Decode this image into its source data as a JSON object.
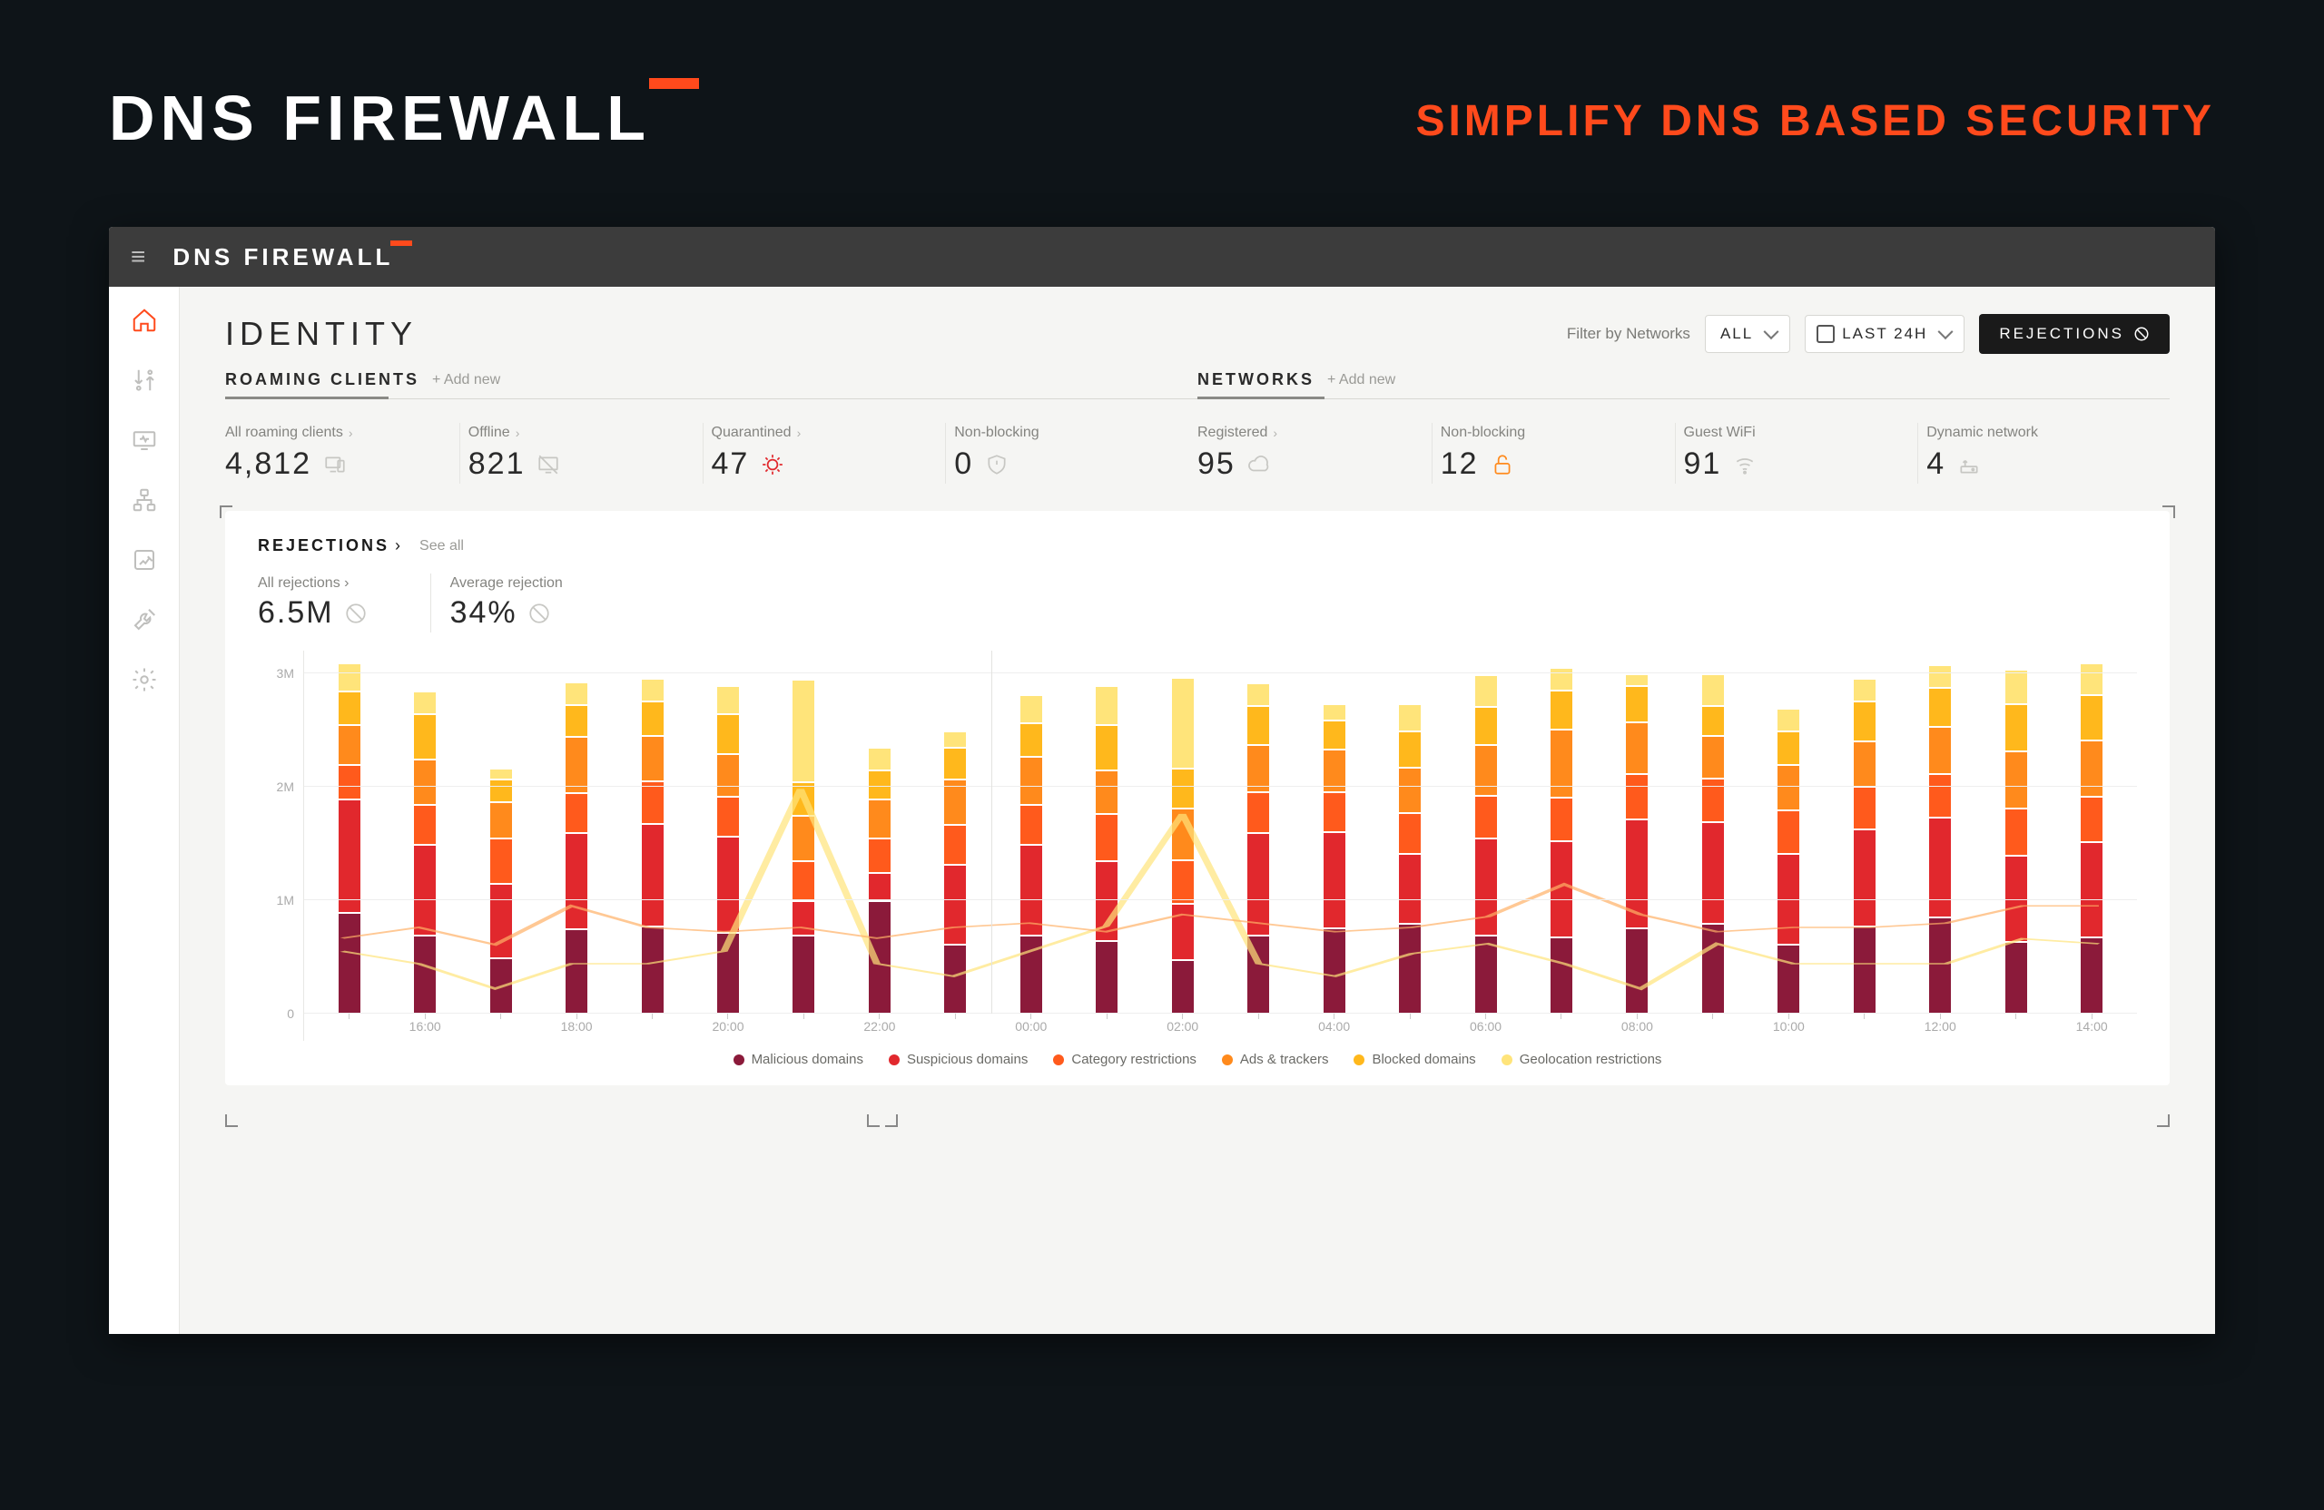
{
  "hero": {
    "title": "DNS FIREWALL",
    "tagline": "SIMPLIFY DNS BASED SECURITY"
  },
  "app_title": "DNS FIREWALL",
  "sidebar": [
    {
      "name": "home",
      "active": true
    },
    {
      "name": "traffic",
      "active": false
    },
    {
      "name": "monitor",
      "active": false
    },
    {
      "name": "network",
      "active": false
    },
    {
      "name": "reports",
      "active": false
    },
    {
      "name": "tools",
      "active": false
    },
    {
      "name": "settings",
      "active": false
    }
  ],
  "page": {
    "title": "IDENTITY",
    "filter_label": "Filter by Networks",
    "network_select": "ALL",
    "time_select": "LAST 24H",
    "rejections_button": "REJECTIONS"
  },
  "tabs": {
    "roaming": {
      "title": "ROAMING CLIENTS",
      "add": "Add new"
    },
    "networks": {
      "title": "NETWORKS",
      "add": "Add new"
    }
  },
  "stats": {
    "roaming": [
      {
        "label": "All roaming clients",
        "value": "4,812",
        "icon": "device",
        "link": true
      },
      {
        "label": "Offline",
        "value": "821",
        "icon": "offline",
        "link": true
      },
      {
        "label": "Quarantined",
        "value": "47",
        "icon": "virus",
        "icon_color": "red",
        "link": true
      },
      {
        "label": "Non-blocking",
        "value": "0",
        "icon": "shield",
        "link": false
      }
    ],
    "networks": [
      {
        "label": "Registered",
        "value": "95",
        "icon": "cloud",
        "link": true
      },
      {
        "label": "Non-blocking",
        "value": "12",
        "icon": "unlock",
        "icon_color": "orange",
        "link": false
      },
      {
        "label": "Guest WiFi",
        "value": "91",
        "icon": "wifi",
        "link": false
      },
      {
        "label": "Dynamic network",
        "value": "4",
        "icon": "router",
        "link": false
      }
    ]
  },
  "rejections": {
    "title": "REJECTIONS",
    "see_all": "See all",
    "summary": [
      {
        "label": "All rejections",
        "value": "6.5M",
        "link": true
      },
      {
        "label": "Average rejection",
        "value": "34%",
        "link": false
      }
    ]
  },
  "colors": {
    "accent": "#ff4a1c",
    "series": {
      "malicious": "#8b1a3a",
      "suspicious": "#e1282d",
      "category": "#ff5a1c",
      "ads": "#ff8a1c",
      "blocked": "#ffb81c",
      "geo": "#ffe47a"
    }
  },
  "chart_data": {
    "type": "bar",
    "stacked": true,
    "ylabel": "",
    "xlabel": "",
    "ylim": [
      0,
      3200000
    ],
    "y_ticks": [
      0,
      1000000,
      2000000,
      3000000
    ],
    "y_tick_labels": [
      "0",
      "1M",
      "2M",
      "3M"
    ],
    "categories": [
      "",
      "16:00",
      "",
      "18:00",
      "",
      "20:00",
      "",
      "22:00",
      "",
      "00:00",
      "",
      "02:00",
      "",
      "04:00",
      "",
      "06:00",
      "",
      "08:00",
      "",
      "10:00",
      "",
      "12:00",
      "",
      "14:00"
    ],
    "legend": [
      {
        "key": "malicious",
        "label": "Malicious domains"
      },
      {
        "key": "suspicious",
        "label": "Suspicious domains"
      },
      {
        "key": "category",
        "label": "Category restrictions"
      },
      {
        "key": "ads",
        "label": "Ads & trackers"
      },
      {
        "key": "blocked",
        "label": "Blocked domains"
      },
      {
        "key": "geo",
        "label": "Geolocation restrictions"
      }
    ],
    "series": [
      {
        "name": "malicious",
        "values": [
          900000,
          700000,
          500000,
          750000,
          780000,
          720000,
          700000,
          1000000,
          620000,
          700000,
          650000,
          480000,
          700000,
          760000,
          800000,
          700000,
          680000,
          760000,
          800000,
          620000,
          780000,
          860000,
          640000,
          680000
        ]
      },
      {
        "name": "suspicious",
        "values": [
          1000000,
          800000,
          650000,
          850000,
          900000,
          850000,
          300000,
          250000,
          700000,
          800000,
          700000,
          500000,
          900000,
          850000,
          620000,
          850000,
          850000,
          960000,
          900000,
          800000,
          850000,
          880000,
          760000,
          840000
        ]
      },
      {
        "name": "category",
        "values": [
          300000,
          350000,
          400000,
          350000,
          380000,
          350000,
          350000,
          300000,
          350000,
          350000,
          420000,
          380000,
          360000,
          350000,
          360000,
          380000,
          380000,
          400000,
          380000,
          380000,
          380000,
          380000,
          420000,
          400000
        ]
      },
      {
        "name": "ads",
        "values": [
          350000,
          400000,
          320000,
          500000,
          400000,
          380000,
          400000,
          350000,
          400000,
          420000,
          380000,
          460000,
          420000,
          380000,
          400000,
          450000,
          600000,
          460000,
          380000,
          400000,
          400000,
          420000,
          500000,
          500000
        ]
      },
      {
        "name": "blocked",
        "values": [
          300000,
          400000,
          200000,
          280000,
          300000,
          350000,
          300000,
          250000,
          280000,
          300000,
          400000,
          350000,
          340000,
          250000,
          320000,
          330000,
          350000,
          320000,
          260000,
          300000,
          350000,
          340000,
          420000,
          400000
        ]
      },
      {
        "name": "geo",
        "values": [
          250000,
          200000,
          100000,
          200000,
          200000,
          250000,
          900000,
          200000,
          150000,
          250000,
          350000,
          800000,
          200000,
          150000,
          240000,
          280000,
          200000,
          100000,
          280000,
          200000,
          200000,
          200000,
          300000,
          280000
        ]
      }
    ],
    "divider_after_index": 8
  }
}
